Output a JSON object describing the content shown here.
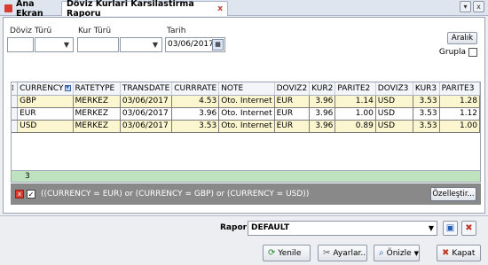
{
  "tabs": {
    "home": "Ana Ekran",
    "active": "Döviz Kurlari Karsilastirma Raporu",
    "close": "x"
  },
  "window_buttons": [
    "▾",
    "x"
  ],
  "filters": {
    "doviz_turu_label": "Döviz Türü",
    "kur_turu_label": "Kur Türü",
    "tarih_label": "Tarih",
    "tarih_value": "03/06/2017",
    "aralik_label": "Aralık",
    "grupla_label": "Grupla"
  },
  "grid": {
    "columns": [
      "CURRENCY",
      "RATETYPE",
      "TRANSDATE",
      "CURRRATE",
      "NOTE",
      "DOVIZ2",
      "KUR2",
      "PARITE2",
      "DOVIZ3",
      "KUR3",
      "PARITE3"
    ],
    "rows": [
      [
        "GBP",
        "MERKEZ",
        "03/06/2017",
        "4.53",
        "Oto. Internet",
        "EUR",
        "3.96",
        "1.14",
        "USD",
        "3.53",
        "1.28"
      ],
      [
        "EUR",
        "MERKEZ",
        "03/06/2017",
        "3.96",
        "Oto. Internet",
        "EUR",
        "3.96",
        "1.00",
        "USD",
        "3.53",
        "1.12"
      ],
      [
        "USD",
        "MERKEZ",
        "03/06/2017",
        "3.53",
        "Oto. Internet",
        "EUR",
        "3.96",
        "0.89",
        "USD",
        "3.53",
        "1.00"
      ]
    ],
    "record_count": "3"
  },
  "filter_bar": {
    "expression": "((CURRENCY = EUR) or (CURRENCY = GBP) or (CURRENCY = USD))",
    "customize_label": "Özelleştir..."
  },
  "report": {
    "label": "Rapor",
    "value": "DEFAULT"
  },
  "actions": {
    "refresh": "Yenile",
    "settings": "Ayarlar..",
    "preview": "Önizle",
    "close": "Kapat"
  },
  "colors": {
    "row_highlight": "#fbf6cf",
    "footer_green": "#bfe3bf",
    "filter_bar": "#898989"
  }
}
